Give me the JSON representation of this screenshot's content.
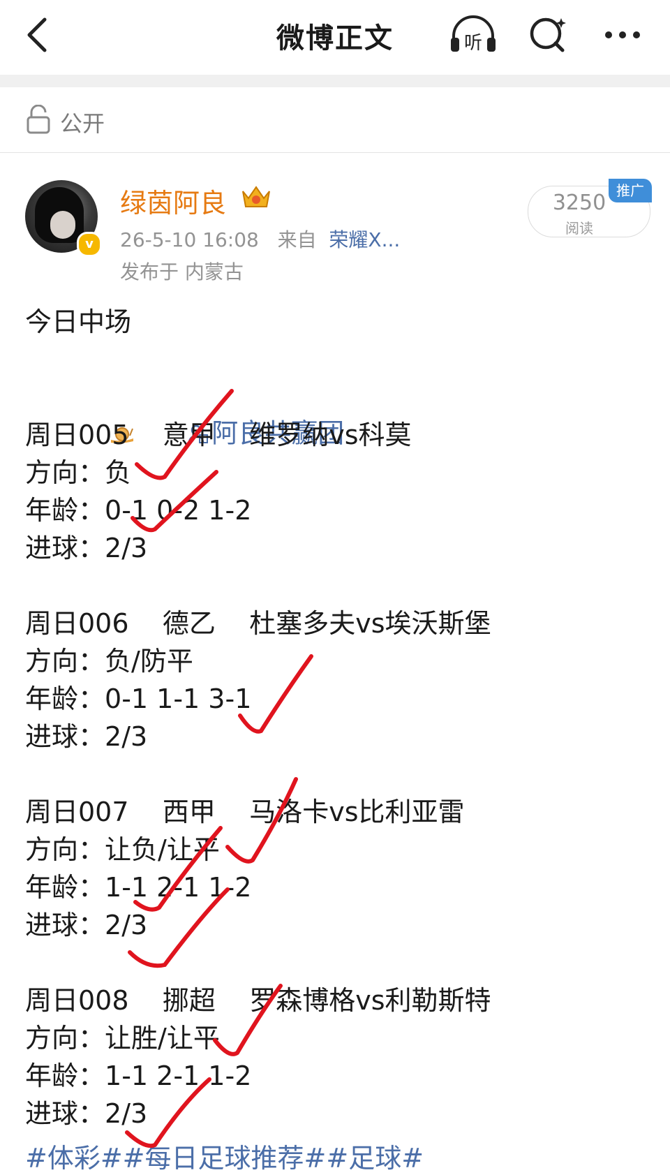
{
  "header": {
    "title": "微博正文"
  },
  "visibility": {
    "label": "公开"
  },
  "post": {
    "author": "绿茵阿良",
    "verified_badge": "v",
    "timestamp": "26-5-10 16:08",
    "source_prefix": "来自",
    "source": "荣耀X...",
    "location": "发布于 内蒙古",
    "reads": "3250",
    "reads_label": "阅读",
    "promo_badge": "推广",
    "intro": "今日中场",
    "group_link": "阿良共赢团",
    "matches": [
      {
        "code": "周日005",
        "league": "意甲",
        "teams": "维罗纳vs科莫",
        "direction_label": "方向：",
        "direction": "负",
        "score_label": "年龄：",
        "scores": "0-1 0-2 1-2",
        "goals_label": "进球：",
        "goals": "2/3"
      },
      {
        "code": "周日006",
        "league": "德乙",
        "teams": "杜塞多夫vs埃沃斯堡",
        "direction_label": "方向：",
        "direction": "负/防平",
        "score_label": "年龄：",
        "scores": "0-1 1-1 3-1",
        "goals_label": "进球：",
        "goals": "2/3"
      },
      {
        "code": "周日007",
        "league": "西甲",
        "teams": "马洛卡vs比利亚雷",
        "direction_label": "方向：",
        "direction": "让负/让平",
        "score_label": "年龄：",
        "scores": "1-1 2-1 1-2",
        "goals_label": "进球：",
        "goals": "2/3"
      },
      {
        "code": "周日008",
        "league": "挪超",
        "teams": "罗森博格vs利勒斯特",
        "direction_label": "方向：",
        "direction": "让胜/让平",
        "score_label": "年龄：",
        "scores": "1-1 2-1 1-2",
        "goals_label": "进球：",
        "goals": "2/3"
      }
    ],
    "hashtags": "#体彩##每日足球推荐##足球#"
  },
  "icons": [
    "back-arrow-icon",
    "listen-headphone-icon",
    "search-icon",
    "more-icon",
    "lock-icon",
    "crown-badge-icon",
    "snail-emoji-icon",
    "group-icon",
    "red-check-mark-icon"
  ],
  "colors": {
    "username": "#e67a12",
    "link": "#4b6ea8",
    "check": "#e0141e",
    "promo": "#3f8ed9"
  }
}
